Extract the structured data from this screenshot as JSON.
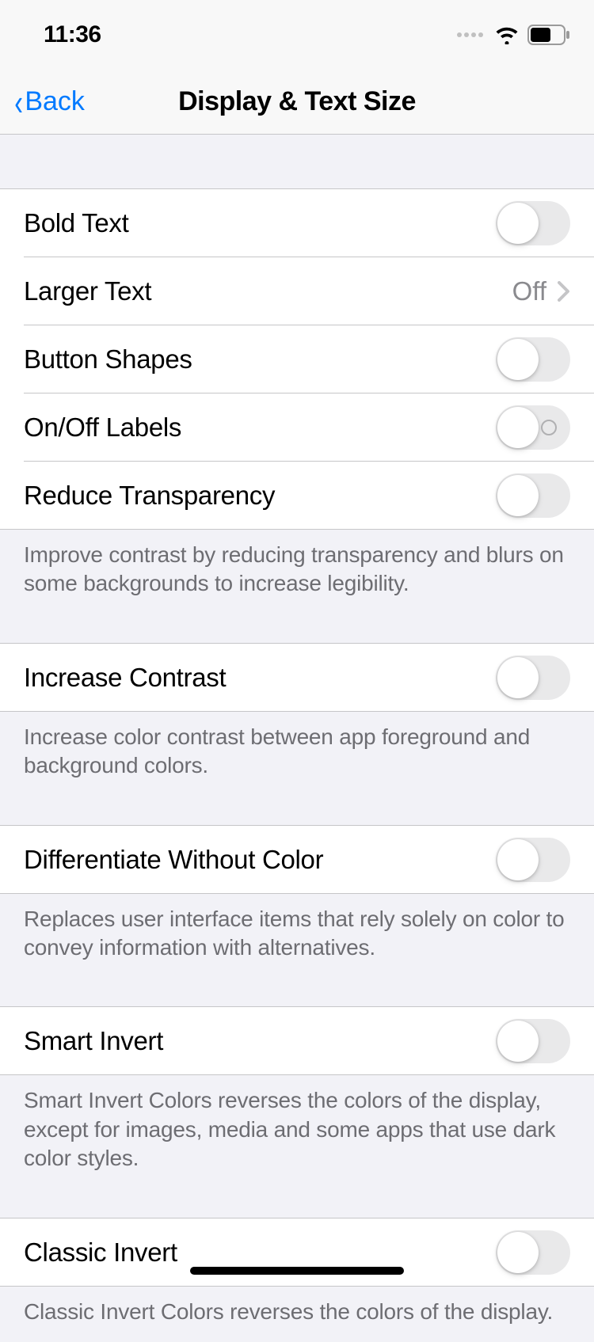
{
  "statusBar": {
    "time": "11:36"
  },
  "nav": {
    "back": "Back",
    "title": "Display & Text Size"
  },
  "rows": {
    "boldText": "Bold Text",
    "largerText": "Larger Text",
    "largerTextValue": "Off",
    "buttonShapes": "Button Shapes",
    "onOffLabels": "On/Off Labels",
    "reduceTransparency": "Reduce Transparency",
    "increaseContrast": "Increase Contrast",
    "diffWithoutColor": "Differentiate Without Color",
    "smartInvert": "Smart Invert",
    "classicInvert": "Classic Invert"
  },
  "footers": {
    "reduceTransparency": "Improve contrast by reducing transparency and blurs on some backgrounds to increase legibility.",
    "increaseContrast": "Increase color contrast between app foreground and background colors.",
    "diffWithoutColor": "Replaces user interface items that rely solely on color to convey information with alternatives.",
    "smartInvert": "Smart Invert Colors reverses the colors of the display, except for images, media and some apps that use dark color styles.",
    "classicInvert": "Classic Invert Colors reverses the colors of the display."
  }
}
